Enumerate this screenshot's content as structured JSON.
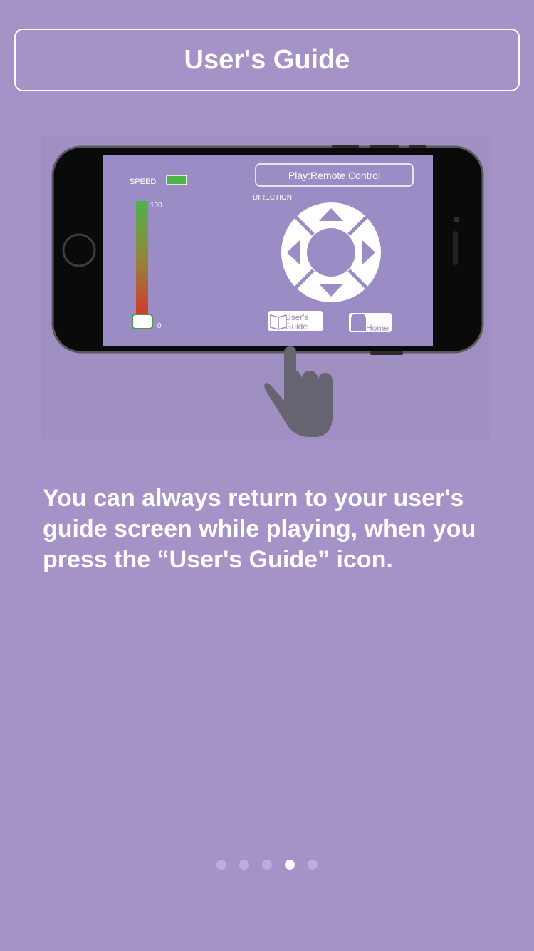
{
  "header": {
    "title": "User's Guide"
  },
  "illustration": {
    "phone_title": "Play:Remote Control",
    "speed_label": "SPEED",
    "speed_max": "100",
    "speed_min": "0",
    "direction_label": "DIRECTION",
    "guide_button_line1": "User's",
    "guide_button_line2": "Guide",
    "home_button_label": "Home"
  },
  "body": {
    "instruction_text": "You can always return to your user's guide screen while playing, when you press the “User's Guide” icon."
  },
  "pager": {
    "total_pages": 5,
    "current_page": 4
  },
  "colors": {
    "background": "#a593c7",
    "screen": "#9c8cc5",
    "speed_top": "#4fb24a",
    "speed_bottom": "#d8322c",
    "hand": "#676472"
  }
}
